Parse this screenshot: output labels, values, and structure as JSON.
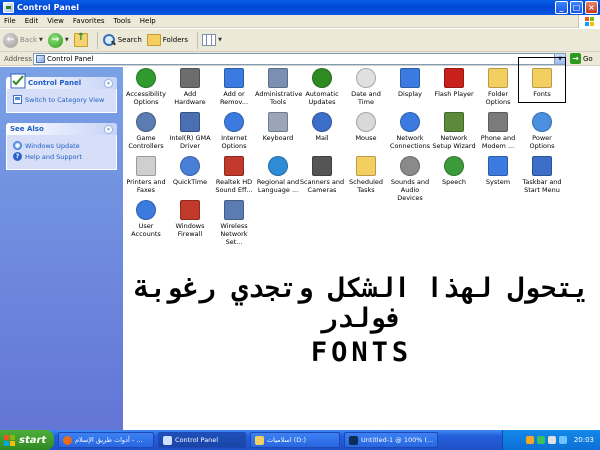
{
  "window": {
    "title": "Control Panel"
  },
  "menu": [
    "File",
    "Edit",
    "View",
    "Favorites",
    "Tools",
    "Help"
  ],
  "toolbar": {
    "back": "Back",
    "search": "Search",
    "folders": "Folders"
  },
  "address": {
    "label": "Address",
    "value": "Control Panel",
    "go": "Go"
  },
  "sidebar": {
    "panel1": {
      "title": "Control Panel",
      "links": [
        "Switch to Category View"
      ]
    },
    "panel2": {
      "title": "See Also",
      "links": [
        "Windows Update",
        "Help and Support"
      ]
    }
  },
  "items": [
    "Accessibility Options",
    "Add Hardware",
    "Add or Remov...",
    "Administrative Tools",
    "Automatic Updates",
    "Date and Time",
    "Display",
    "Flash Player",
    "Folder Options",
    "Fonts",
    "Game Controllers",
    "Intel(R) GMA Driver",
    "Internet Options",
    "Keyboard",
    "Mail",
    "Mouse",
    "Network Connections",
    "Network Setup Wizard",
    "Phone and Modem ...",
    "Power Options",
    "Printers and Faxes",
    "QuickTime",
    "Realtek HD Sound Eff...",
    "Regional and Language ...",
    "Scanners and Cameras",
    "Scheduled Tasks",
    "Sounds and Audio Devices",
    "Speech",
    "System",
    "Taskbar and Start Menu",
    "User Accounts",
    "Windows Firewall",
    "Wireless Network Set..."
  ],
  "overlay": {
    "line1": "يتحول لهذا الشكل وتجدي رغوبة",
    "line2": "فولدر",
    "line3": "FONTS"
  },
  "taskbar": {
    "start": "start",
    "tasks": [
      "أدوات طريق الإسلام - ...",
      "Control Panel",
      "اسلاميات (D:)",
      "Untitled-1 @ 100% (..."
    ],
    "clock": "20:03"
  }
}
